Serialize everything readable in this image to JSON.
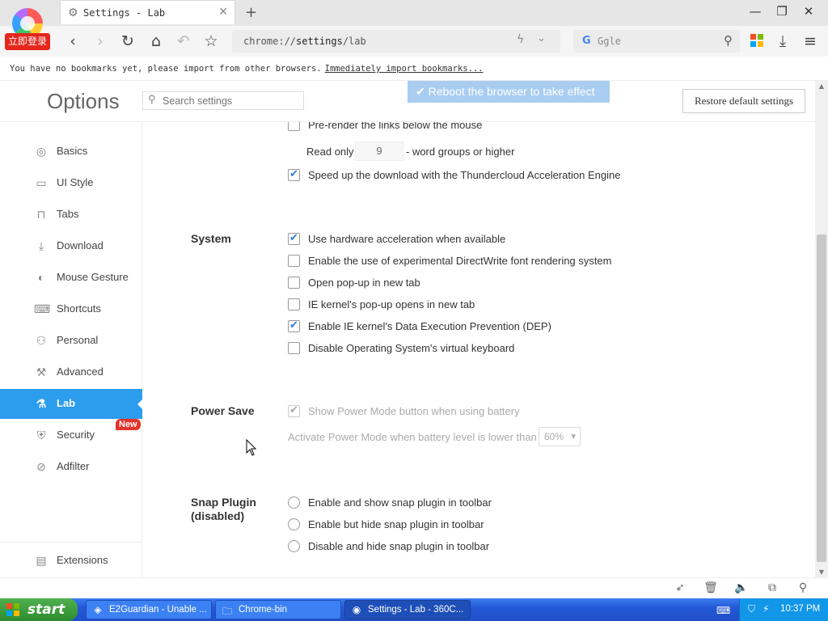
{
  "browser": {
    "logo_badge": "立即登录",
    "tab": {
      "title": "Settings - Lab",
      "icon": "gear-icon"
    },
    "window_controls": {
      "minimize": "—",
      "restore": "❐",
      "close": "✕"
    },
    "toolbar": {
      "url_prefix": "chrome://",
      "url_path": "settings",
      "url_suffix": "/lab",
      "search_engine_letter": "G",
      "search_placeholder": "Ggle"
    },
    "bookmark_notice": {
      "text": "You have no bookmarks yet, please import from other browsers.",
      "link": "Immediately import bookmarks..."
    }
  },
  "options": {
    "title": "Options",
    "search_placeholder": "Search settings",
    "toast": "Reboot the browser to take effect",
    "restore_button": "Restore default settings"
  },
  "sidebar": {
    "items": [
      {
        "label": "Basics",
        "icon": "target-icon",
        "glyph": "◎"
      },
      {
        "label": "UI Style",
        "icon": "window-icon",
        "glyph": "▭"
      },
      {
        "label": "Tabs",
        "icon": "tab-icon",
        "glyph": "⊓"
      },
      {
        "label": "Download",
        "icon": "download-icon",
        "glyph": "⤓"
      },
      {
        "label": "Mouse Gesture",
        "icon": "mouse-icon",
        "glyph": "◐"
      },
      {
        "label": "Shortcuts",
        "icon": "keyboard-icon",
        "glyph": "⌨"
      },
      {
        "label": "Personal",
        "icon": "person-icon",
        "glyph": "⚇"
      },
      {
        "label": "Advanced",
        "icon": "wrench-icon",
        "glyph": "⚒"
      },
      {
        "label": "Lab",
        "icon": "flask-icon",
        "glyph": "⚗",
        "active": true
      },
      {
        "label": "Security",
        "icon": "shield-icon",
        "glyph": "⛨"
      },
      {
        "label": "Adfilter",
        "icon": "block-icon",
        "glyph": "⊘"
      }
    ],
    "new_badge": "New",
    "extensions": {
      "label": "Extensions",
      "icon": "extensions-icon",
      "glyph": "▤"
    }
  },
  "lab": {
    "prerender": {
      "label": "Pre-render the links below the mouse",
      "checked": false
    },
    "read_only": {
      "prefix": "Read only",
      "value": "9",
      "suffix": "- word groups or higher"
    },
    "thundercloud": {
      "label": "Speed up the download with the Thundercloud Acceleration Engine",
      "checked": true
    },
    "system": {
      "title": "System",
      "options": [
        {
          "label": "Use hardware acceleration when available",
          "checked": true
        },
        {
          "label": "Enable the use of experimental DirectWrite font rendering system",
          "checked": false
        },
        {
          "label": "Open pop-up in new tab",
          "checked": false
        },
        {
          "label": "IE kernel's pop-up opens in new tab",
          "checked": false
        },
        {
          "label": "Enable IE kernel's Data Execution Prevention (DEP)",
          "checked": true
        },
        {
          "label": "Disable Operating System's virtual keyboard",
          "checked": false
        }
      ]
    },
    "power_save": {
      "title": "Power Save",
      "show_button": {
        "label": "Show Power Mode button when using battery",
        "checked": true
      },
      "threshold_label": "Activate Power Mode when battery level is lower than",
      "threshold_value": "60%"
    },
    "snap_plugin": {
      "title_line1": "Snap Plugin",
      "title_line2": "(disabled)",
      "options": [
        {
          "label": "Enable and show snap plugin in toolbar"
        },
        {
          "label": "Enable but hide snap plugin in toolbar"
        },
        {
          "label": "Disable and hide snap plugin in toolbar"
        }
      ]
    }
  },
  "taskbar": {
    "start": "start",
    "tasks": [
      {
        "label": "E2Guardian - Unable ...",
        "icon": "e2guardian-icon"
      },
      {
        "label": "Chrome-bin",
        "icon": "folder-icon"
      },
      {
        "label": "Settings - Lab - 360C...",
        "icon": "browser-icon",
        "active": true
      }
    ],
    "clock": "10:37 PM"
  },
  "colors": {
    "accent": "#2c9ced",
    "new_badge": "#e5322d",
    "login_badge": "#e4261c",
    "toast_bg": "#a9cdf0",
    "taskbar": "#245ad6",
    "start_green": "#3a9a3a"
  }
}
